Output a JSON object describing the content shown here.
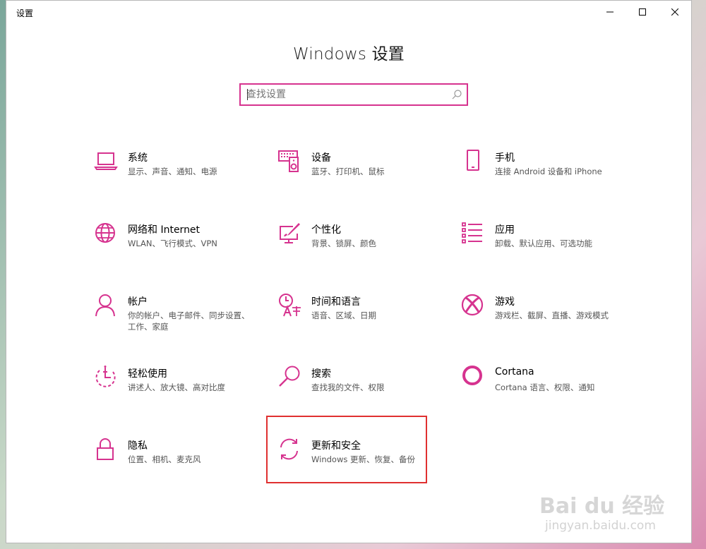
{
  "window": {
    "title": "设置",
    "heading": "Windows 设置"
  },
  "search": {
    "placeholder": "查找设置",
    "value": ""
  },
  "accent_color": "#d6338f",
  "tiles": [
    {
      "title": "系统",
      "desc": "显示、声音、通知、电源",
      "icon": "laptop-icon"
    },
    {
      "title": "设备",
      "desc": "蓝牙、打印机、鼠标",
      "icon": "keyboard-speaker-icon"
    },
    {
      "title": "手机",
      "desc": "连接 Android 设备和 iPhone",
      "icon": "phone-icon"
    },
    {
      "title": "网络和 Internet",
      "desc": "WLAN、飞行模式、VPN",
      "icon": "globe-icon"
    },
    {
      "title": "个性化",
      "desc": "背景、锁屏、颜色",
      "icon": "paint-monitor-icon"
    },
    {
      "title": "应用",
      "desc": "卸载、默认应用、可选功能",
      "icon": "apps-list-icon"
    },
    {
      "title": "帐户",
      "desc": "你的帐户、电子邮件、同步设置、工作、家庭",
      "icon": "person-icon"
    },
    {
      "title": "时间和语言",
      "desc": "语音、区域、日期",
      "icon": "time-language-icon"
    },
    {
      "title": "游戏",
      "desc": "游戏栏、截屏、直播、游戏模式",
      "icon": "xbox-icon"
    },
    {
      "title": "轻松使用",
      "desc": "讲述人、放大镜、高对比度",
      "icon": "ease-of-access-icon"
    },
    {
      "title": "搜索",
      "desc": "查找我的文件、权限",
      "icon": "magnifier-icon"
    },
    {
      "title": "Cortana",
      "desc": "Cortana 语言、权限、通知",
      "icon": "cortana-icon"
    },
    {
      "title": "隐私",
      "desc": "位置、相机、麦克风",
      "icon": "lock-icon"
    },
    {
      "title": "更新和安全",
      "desc": "Windows 更新、恢复、备份",
      "icon": "sync-icon"
    }
  ],
  "highlighted_tile": "更新和安全",
  "watermark": {
    "line1": "Bai du 经验",
    "line2": "jingyan.baidu.com"
  }
}
